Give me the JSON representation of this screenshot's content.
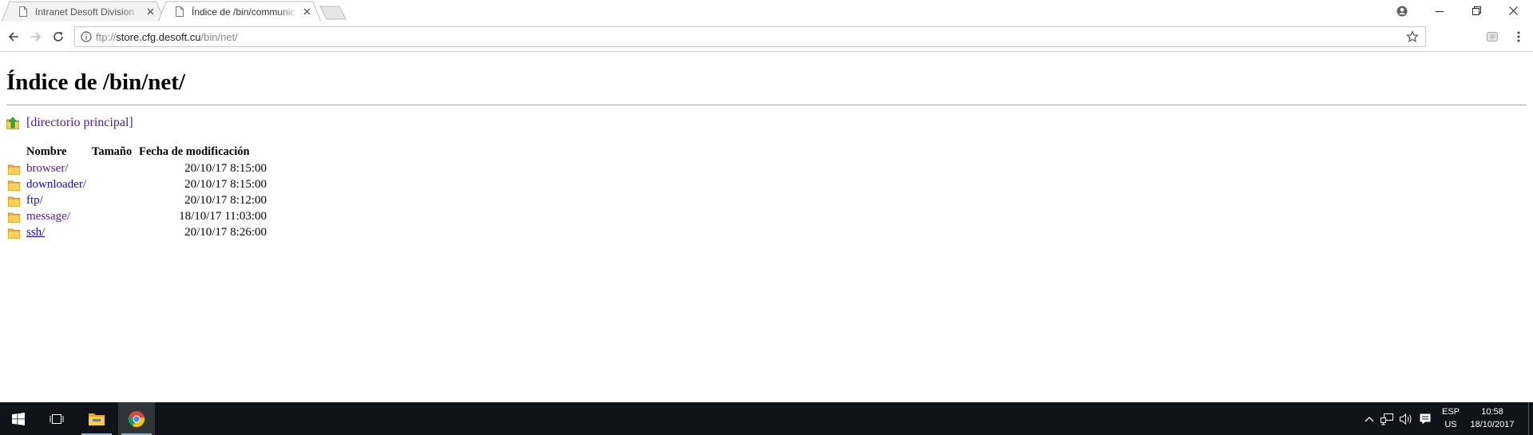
{
  "browser": {
    "tabs": [
      {
        "title": "Intranet Desoft Division",
        "active": false
      },
      {
        "title": "Índice de /bin/communic",
        "active": true
      }
    ],
    "url": {
      "scheme": "ftp://",
      "host": "store.cfg.desoft.cu",
      "path": "/bin/net/"
    }
  },
  "page": {
    "heading": "Índice de /bin/net/",
    "parent_link": "[directorio principal]",
    "columns": {
      "name": "Nombre",
      "size": "Tamaño",
      "modified": "Fecha de modificación"
    },
    "entries": [
      {
        "name": "browser/",
        "size": "",
        "modified": "20/10/17 8:15:00"
      },
      {
        "name": "downloader/",
        "size": "",
        "modified": "20/10/17 8:15:00"
      },
      {
        "name": "ftp/",
        "size": "",
        "modified": "20/10/17 8:12:00"
      },
      {
        "name": "message/",
        "size": "",
        "modified": "18/10/17 11:03:00"
      },
      {
        "name": "ssh/",
        "size": "",
        "modified": "20/10/17 8:26:00"
      }
    ]
  },
  "taskbar": {
    "apps": [
      "start-icon",
      "task-view-icon",
      "file-explorer-icon",
      "chrome-icon"
    ],
    "language": {
      "line1": "ESP",
      "line2": "US"
    },
    "clock": {
      "time": "10:58",
      "date": "18/10/2017"
    }
  },
  "colors": {
    "link": "#1a0dab",
    "visited_link": "#551a8b",
    "taskbar": "#10131a",
    "folder": "#f2c14e"
  }
}
